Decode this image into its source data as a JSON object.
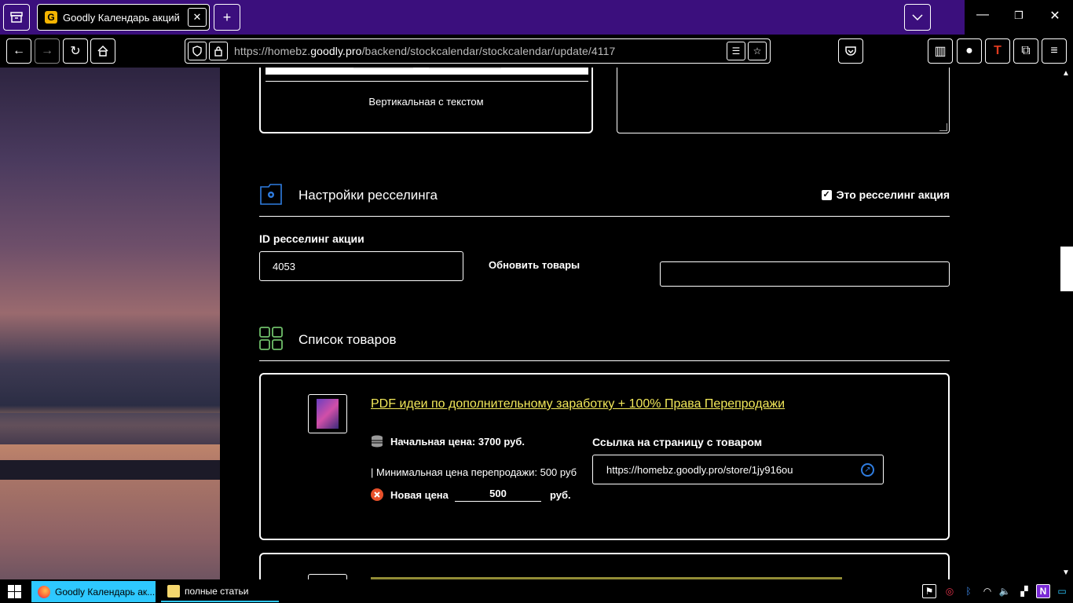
{
  "browser": {
    "tab_title": "Goodly Календарь акций",
    "tab_favicon": "G",
    "url_prefix": "https://homebz.",
    "url_domain": "goodly.pro",
    "url_path": "/backend/stockcalendar/stockcalendar/update/4117"
  },
  "content": {
    "card_label": "Вертикальная с текстом",
    "resell_section": {
      "title": "Настройки ресселинга",
      "checkbox_label": "Это ресселинг акция",
      "checkbox_checked": true,
      "id_label": "ID ресселинг акции",
      "id_value": "4053",
      "refresh_label": "Обновить товары",
      "extra_value": ""
    },
    "products_section": {
      "title": "Список товаров"
    },
    "product": {
      "title": "PDF идеи по дополнительному заработку + 100% Права Перепродажи",
      "start_price": "Начальная цена: 3700 руб.",
      "min_price": "| Минимальная цена перепродажи: 500 руб",
      "new_price_label": "Новая цена",
      "new_price_value": "500",
      "currency": "руб.",
      "link_label": "Ссылка на страницу с товаром",
      "link_value": "https://homebz.goodly.pro/store/1jy916ou"
    }
  },
  "taskbar": {
    "tasks": [
      {
        "label": "Goodly Календарь ак..."
      },
      {
        "label": "полные статьи"
      }
    ]
  },
  "colors": {
    "tabstrip": "#3b0f7d",
    "accent_yellow": "#f3e95a",
    "link_icon": "#2f7de1",
    "taskbar_active": "#2ec8ff"
  }
}
